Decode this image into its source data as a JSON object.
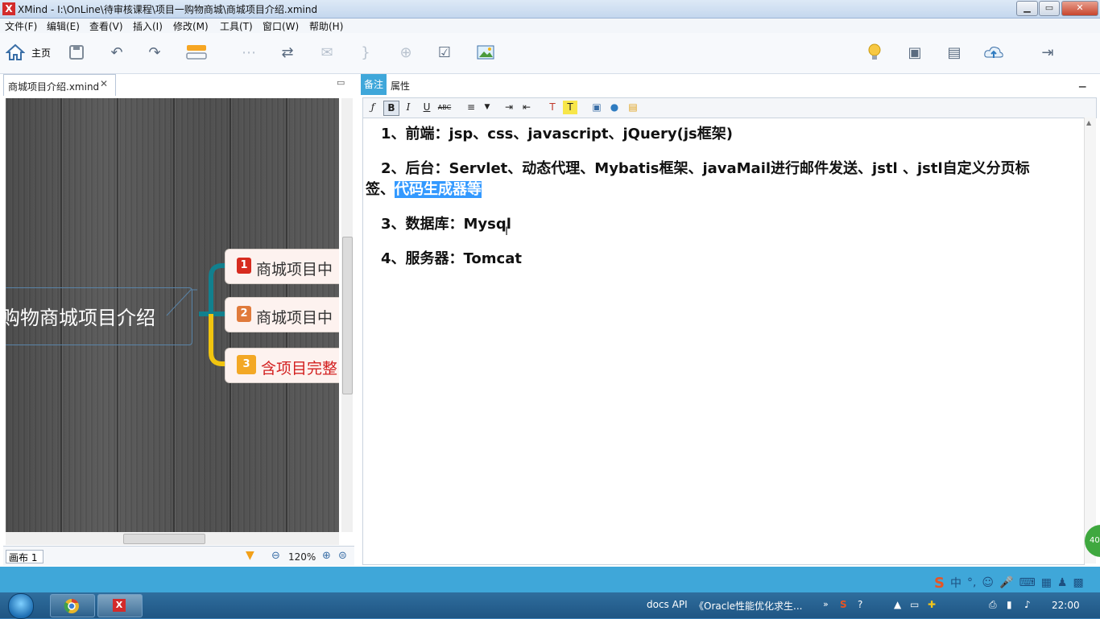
{
  "window": {
    "title": "XMind - I:\\OnLine\\待审核课程\\项目一购物商城\\商城项目介绍.xmind",
    "logo": "X"
  },
  "menu": [
    "文件(F)",
    "编辑(E)",
    "查看(V)",
    "插入(I)",
    "修改(M)",
    "工具(T)",
    "窗口(W)",
    "帮助(H)"
  ],
  "toolbar": {
    "home_label": "主页"
  },
  "editor_tab": {
    "label": "商城项目介绍.xmind"
  },
  "mindmap": {
    "central": "购物商城项目介绍",
    "branches": [
      {
        "num": "1",
        "text": "商城项目中",
        "color": "#d72b1f",
        "line": "#11808e"
      },
      {
        "num": "2",
        "text": "商城项目中",
        "color": "#e07a3b",
        "line": "#11808e"
      },
      {
        "num": "3",
        "text": "含项目完整",
        "color": "#f3a825",
        "line": "#f1c40f"
      }
    ]
  },
  "status_left": {
    "sheet": "画布 1",
    "zoom": "120%"
  },
  "right_tabs": {
    "notes": "备注",
    "props": "属性"
  },
  "notes": {
    "l1": "1、前端：jsp、css、javascript、jQuery(js框架)",
    "l2a": "2、后台：Servlet、动态代理、Mybatis框架、javaMail进行邮件发送、jstl 、jstl自定义分页标",
    "l2b_plain": "签、",
    "l2b_sel": "代码生成器等",
    "l3": "3、数据库：Mysql",
    "l4": "4、服务器：Tomcat"
  },
  "badge": "40",
  "ime": {
    "logo": "S",
    "mode": "中",
    "punct": "°,"
  },
  "taskbar": {
    "item1": "docs API",
    "item2": "《Oracle性能优化求生...",
    "clock": "22:00"
  }
}
